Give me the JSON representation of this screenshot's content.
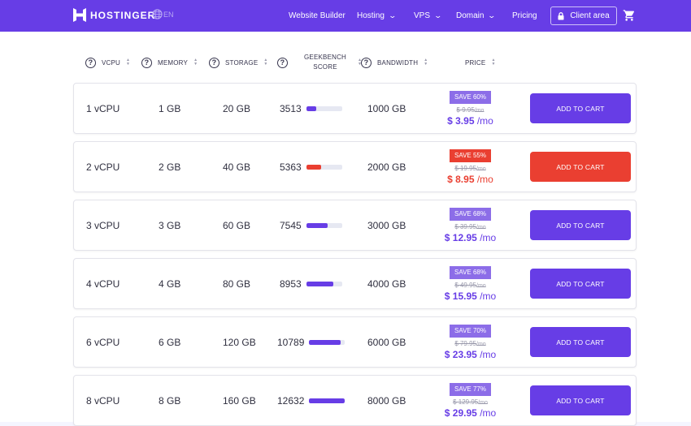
{
  "colors": {
    "brand": "#673de6",
    "purple_badge": "#8c6de8",
    "red": "#ea3f31",
    "purple_price": "#673de6"
  },
  "header": {
    "logo_text": "HOSTINGER",
    "language": "EN",
    "nav": [
      {
        "label": "Website Builder",
        "dropdown": false
      },
      {
        "label": "Hosting",
        "dropdown": true
      },
      {
        "label": "VPS",
        "dropdown": true
      },
      {
        "label": "Domain",
        "dropdown": true
      },
      {
        "label": "Pricing",
        "dropdown": false
      }
    ],
    "client_area": "Client area",
    "icons": {
      "logo": "hostinger-logo-icon",
      "globe": "globe-icon",
      "lock": "lock-icon",
      "cart": "shopping-cart-icon",
      "chevron": "chevron-down-icon"
    }
  },
  "table": {
    "columns": [
      {
        "label": "VCPU",
        "help": true,
        "sortable": true
      },
      {
        "label": "MEMORY",
        "help": true,
        "sortable": true
      },
      {
        "label": "STORAGE",
        "help": true,
        "sortable": true
      },
      {
        "label": "GEEKBENCH",
        "label2": "SCORE",
        "help": true,
        "sortable": true
      },
      {
        "label": "BANDWIDTH",
        "help": true,
        "sortable": true
      },
      {
        "label": "PRICE",
        "help": false,
        "sortable": true
      }
    ],
    "rows": [
      {
        "vcpu": "1 vCPU",
        "memory": "1 GB",
        "storage": "20 GB",
        "geekbench": "3513",
        "bench_fraction": 0.28,
        "bandwidth": "1000 GB",
        "save": "SAVE 60%",
        "old_price": "$ 9.95",
        "old_unit": "/mo",
        "price": "$ 3.95",
        "unit": "/mo",
        "cta": "ADD TO CART",
        "highlight": false
      },
      {
        "vcpu": "2 vCPU",
        "memory": "2 GB",
        "storage": "40 GB",
        "geekbench": "5363",
        "bench_fraction": 0.42,
        "bandwidth": "2000 GB",
        "save": "SAVE 55%",
        "old_price": "$ 19.95",
        "old_unit": "/mo",
        "price": "$ 8.95",
        "unit": "/mo",
        "cta": "ADD TO CART",
        "highlight": true
      },
      {
        "vcpu": "3 vCPU",
        "memory": "3 GB",
        "storage": "60 GB",
        "geekbench": "7545",
        "bench_fraction": 0.6,
        "bandwidth": "3000 GB",
        "save": "SAVE 68%",
        "old_price": "$ 39.95",
        "old_unit": "/mo",
        "price": "$ 12.95",
        "unit": "/mo",
        "cta": "ADD TO CART",
        "highlight": false
      },
      {
        "vcpu": "4 vCPU",
        "memory": "4 GB",
        "storage": "80 GB",
        "geekbench": "8953",
        "bench_fraction": 0.75,
        "bandwidth": "4000 GB",
        "save": "SAVE 68%",
        "old_price": "$ 49.95",
        "old_unit": "/mo",
        "price": "$ 15.95",
        "unit": "/mo",
        "cta": "ADD TO CART",
        "highlight": false
      },
      {
        "vcpu": "6 vCPU",
        "memory": "6 GB",
        "storage": "120 GB",
        "geekbench": "10789",
        "bench_fraction": 0.88,
        "bandwidth": "6000 GB",
        "save": "SAVE 70%",
        "old_price": "$ 79.95",
        "old_unit": "/mo",
        "price": "$ 23.95",
        "unit": "/mo",
        "cta": "ADD TO CART",
        "highlight": false
      },
      {
        "vcpu": "8 vCPU",
        "memory": "8 GB",
        "storage": "160 GB",
        "geekbench": "12632",
        "bench_fraction": 1.0,
        "bandwidth": "8000 GB",
        "save": "SAVE 77%",
        "old_price": "$ 129.95",
        "old_unit": "/mo",
        "price": "$ 29.95",
        "unit": "/mo",
        "cta": "ADD TO CART",
        "highlight": false
      }
    ]
  }
}
